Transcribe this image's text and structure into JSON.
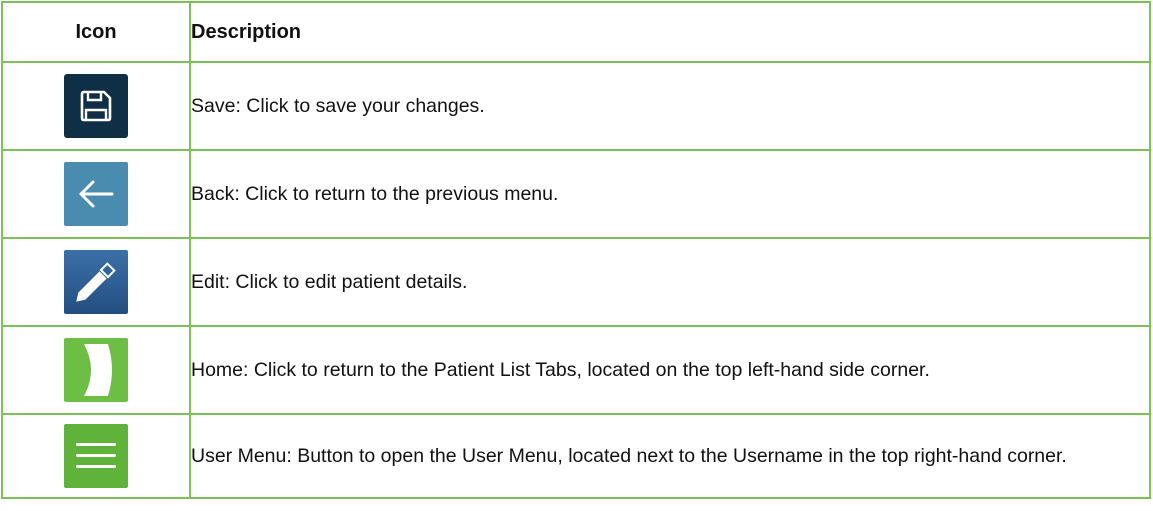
{
  "table": {
    "header_icon": "Icon",
    "header_description": "Description"
  },
  "rows": [
    {
      "icon": "save-icon",
      "color": "#0f2f47",
      "text": "Save: Click to save your changes."
    },
    {
      "icon": "back-arrow-icon",
      "color": "#4a8caf",
      "text": "Back: Click to return to the previous menu."
    },
    {
      "icon": "pencil-edit-icon",
      "color": "#2f5f96",
      "text": "Edit: Click to edit patient details."
    },
    {
      "icon": "home-logo-icon",
      "color": "#6cbf44",
      "text": "Home: Click to return to the Patient List Tabs, located on the top left-hand side corner."
    },
    {
      "icon": "hamburger-menu-icon",
      "color": "#5fb33a",
      "text": "User Menu: Button to open the User Menu, located next to the Username in the top right-hand corner."
    }
  ]
}
